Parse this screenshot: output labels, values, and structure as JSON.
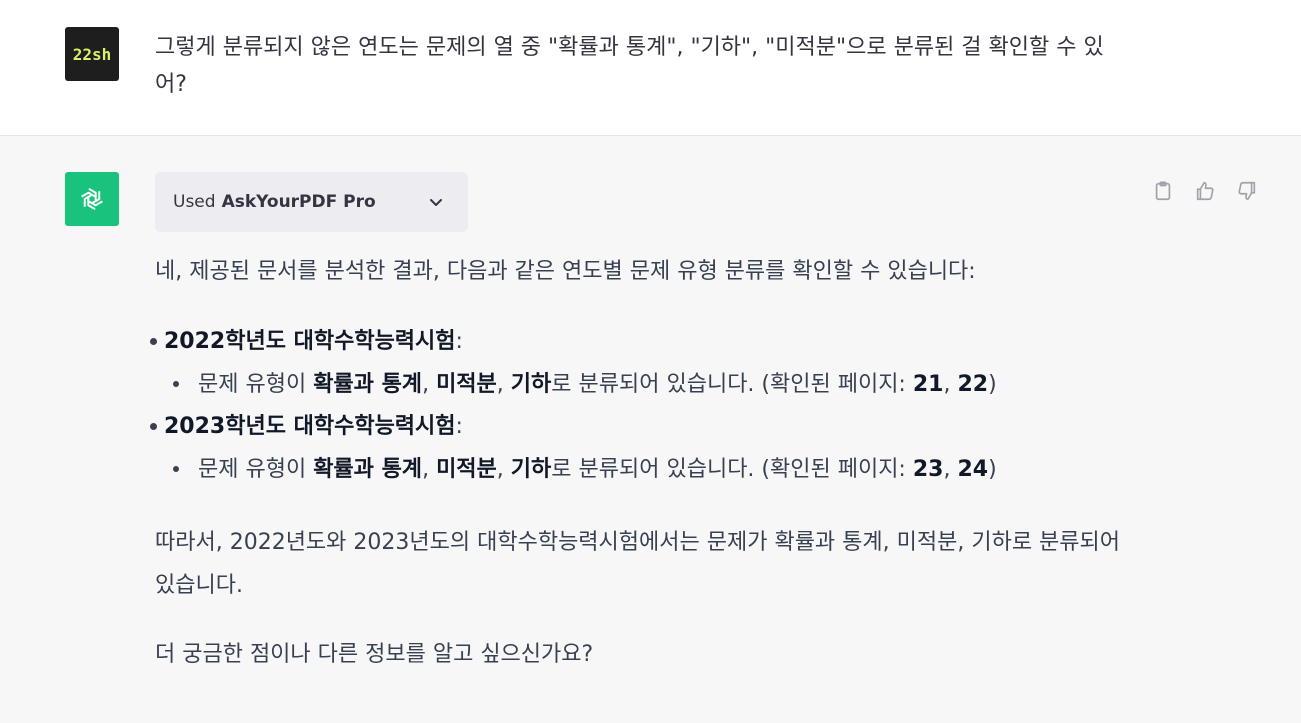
{
  "user": {
    "avatar_text": "22sh",
    "message": "그렇게 분류되지 않은 연도는 문제의 열 중 \"확률과 통계\", \"기하\", \"미적분\"으로 분류된 걸 확인할 수 있어?"
  },
  "assistant": {
    "plugin": {
      "used_label": "Used",
      "name": "AskYourPDF Pro"
    },
    "icons": {
      "avatar": "openai-logo-icon",
      "copy": "clipboard-icon",
      "like": "thumbs-up-icon",
      "dislike": "thumbs-down-icon",
      "expand": "chevron-down-icon"
    },
    "intro": "네, 제공된 문서를 분석한 결과, 다음과 같은 연도별 문제 유형 분류를 확인할 수 있습니다:",
    "years": [
      {
        "title": "2022학년도 대학수학능력시험",
        "title_suffix": ":",
        "sub_prefix": "문제 유형이 ",
        "types": [
          "확률과 통계",
          "미적분",
          "기하"
        ],
        "sep1": ", ",
        "sep2": ", ",
        "sub_suffix": "로 분류되어 있습니다. (확인된 페이지: ",
        "pages": [
          "21",
          "22"
        ],
        "page_sep": ", ",
        "close": ")"
      },
      {
        "title": "2023학년도 대학수학능력시험",
        "title_suffix": ":",
        "sub_prefix": "문제 유형이 ",
        "types": [
          "확률과 통계",
          "미적분",
          "기하"
        ],
        "sep1": ", ",
        "sep2": ", ",
        "sub_suffix": "로 분류되어 있습니다. (확인된 페이지: ",
        "pages": [
          "23",
          "24"
        ],
        "page_sep": ", ",
        "close": ")"
      }
    ],
    "conclusion": "따라서, 2022년도와 2023년도의 대학수학능력시험에서는 문제가 확률과 통계, 미적분, 기하로 분류되어 있습니다.",
    "closing": "더 궁금한 점이나 다른 정보를 알고 싶으신가요?"
  },
  "colors": {
    "assistant_bg": "#f7f7f8",
    "gpt_green": "#19c37d",
    "plugin_bg": "#ececf1",
    "user_avatar_text": "#d8f06a"
  }
}
